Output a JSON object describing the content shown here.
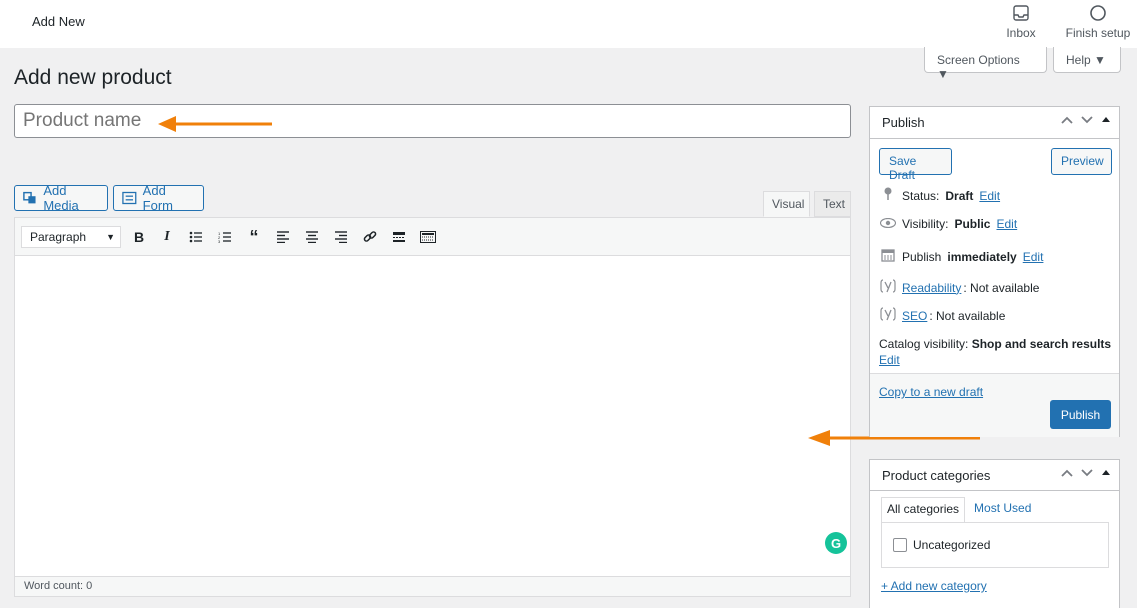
{
  "topbar": {
    "title": "Add New",
    "inbox_label": "Inbox",
    "finish_label": "Finish setup"
  },
  "screen_options": {
    "screen_label": "Screen Options ▼",
    "help_label": "Help ▼"
  },
  "page": {
    "title": "Add new product"
  },
  "title_field": {
    "placeholder": "Product name"
  },
  "media_buttons": {
    "add_media": "Add Media",
    "add_form": "Add Form"
  },
  "editor_tabs": {
    "visual": "Visual",
    "text": "Text"
  },
  "editor": {
    "format_select": "Paragraph",
    "grammarly_letter": "G",
    "word_count": "Word count: 0"
  },
  "publish": {
    "title": "Publish",
    "save_draft": "Save Draft",
    "preview": "Preview",
    "status_label": "Status:",
    "status_value": "Draft",
    "visibility_label": "Visibility:",
    "visibility_value": "Public",
    "publish_label": "Publish",
    "publish_value": "immediately",
    "readability_link": "Readability",
    "readability_value": ": Not available",
    "seo_link": "SEO",
    "seo_value": ": Not available",
    "catalog_label": "Catalog visibility:",
    "catalog_value": "Shop and search results",
    "edit": "Edit",
    "copy_draft": "Copy to a new draft",
    "publish_button": "Publish"
  },
  "categories": {
    "title": "Product categories",
    "tab_all": "All categories",
    "tab_most_used": "Most Used",
    "item_uncategorized": "Uncategorized",
    "add_new": "+ Add new category"
  },
  "colors": {
    "accent": "#2271b1",
    "annotation_arrow": "#f0800a"
  }
}
